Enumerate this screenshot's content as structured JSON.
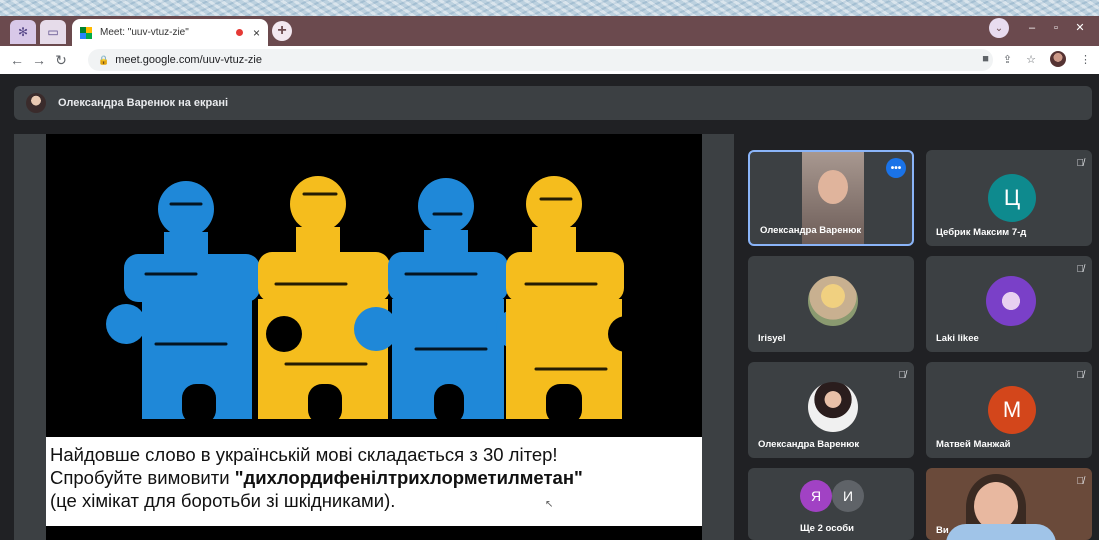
{
  "browser": {
    "active_tab_title": "Meet: \"uuv-vtuz-zie\"",
    "url": "meet.google.com/uuv-vtuz-zie",
    "new_tab_label": "+",
    "tab_close_label": "×"
  },
  "meet": {
    "presenter_banner": "Олександра Варенюк на екрані",
    "slide": {
      "line1": "Найдовше слово в українській мові складається з 30 літер!",
      "line2_prefix": "Спробуйте вимовити ",
      "word": "\"дихлордифенілтрихлорметилметан\"",
      "line3": "(це хімікат для боротьби зі шкідниками)."
    },
    "participants": [
      {
        "name": "Олександра Варенюк",
        "kind": "video",
        "active": true
      },
      {
        "name": "Цебрик Максим 7-д",
        "kind": "letter",
        "letter": "Ц",
        "color": "#0e8a8e"
      },
      {
        "name": "Irisyel",
        "kind": "photo"
      },
      {
        "name": "Laki likee",
        "kind": "photo"
      },
      {
        "name": "Олександра Варенюк",
        "kind": "photo"
      },
      {
        "name": "Матвей Манжай",
        "kind": "letter",
        "letter": "М",
        "color": "#d3461b"
      },
      {
        "name": "Ще 2 особи",
        "kind": "group",
        "letters": [
          "Я",
          "И"
        ]
      },
      {
        "name": "Ви",
        "kind": "video"
      }
    ]
  },
  "colors": {
    "blue_puzzle": "#1f88d8",
    "yellow_puzzle": "#f5bd1d",
    "accent": "#8ab4f8"
  }
}
